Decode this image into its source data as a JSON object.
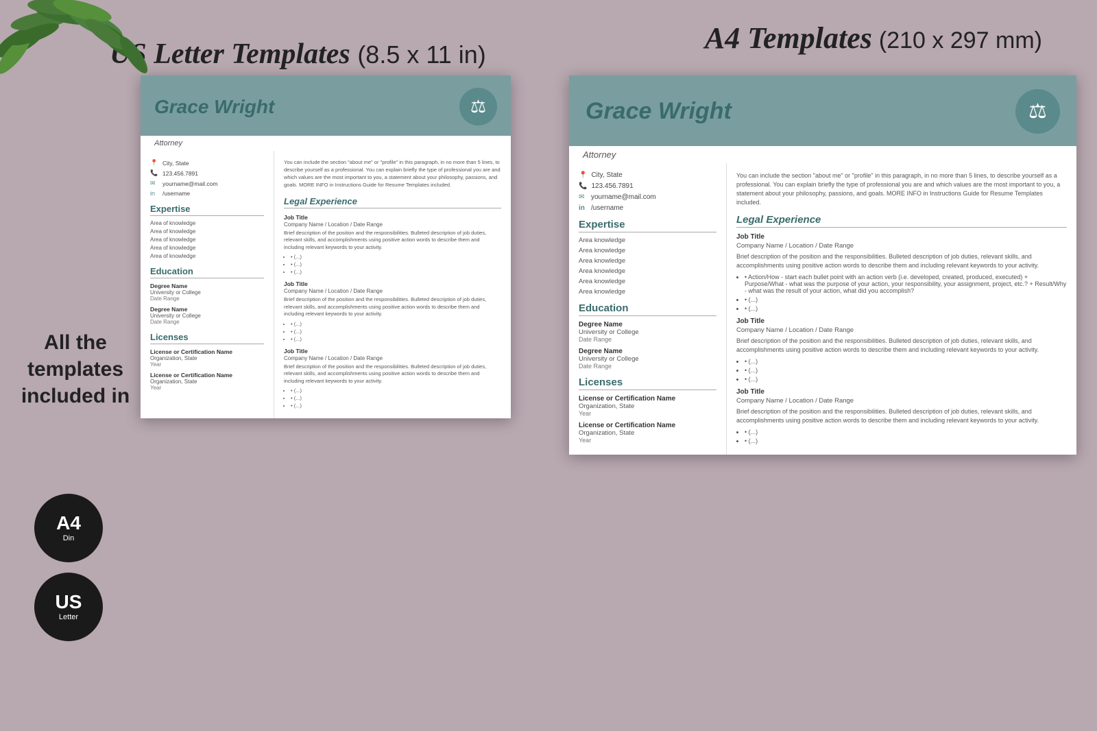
{
  "page": {
    "background_color": "#b8a8b0"
  },
  "title_left": {
    "script_part": "US Letter Templates",
    "normal_part": "(8.5 x 11 in)"
  },
  "title_right": {
    "script_part": "A4 Templates",
    "normal_part": "(210 x 297 mm)"
  },
  "side_text": "All the templates included in",
  "badges": [
    {
      "main": "A4",
      "sub": "Din"
    },
    {
      "main": "US",
      "sub": "Letter"
    }
  ],
  "resume_left": {
    "name": "Grace Wright",
    "title": "Attorney",
    "contact": {
      "location": "City, State",
      "phone": "123.456.7891",
      "email": "yourname@mail.com",
      "linkedin": "/username"
    },
    "expertise_section": "Expertise",
    "expertise_items": [
      "Area of knowledge",
      "Area of knowledge",
      "Area of knowledge",
      "Area of knowledge",
      "Area of knowledge"
    ],
    "education_section": "Education",
    "education": [
      {
        "degree": "Degree Name",
        "school": "University or College",
        "date": "Date Range"
      },
      {
        "degree": "Degree Name",
        "school": "University or College",
        "date": "Date Range"
      }
    ],
    "licenses_section": "Licenses",
    "licenses": [
      {
        "name": "License or Certification Name",
        "org": "Organization, State",
        "year": "Year"
      },
      {
        "name": "License or Certification Name",
        "org": "Organization, State",
        "year": "Year"
      }
    ],
    "legal_exp_section": "Legal Experience",
    "jobs": [
      {
        "title": "Job Title",
        "company": "Company Name / Location / Date Range",
        "desc": "Brief description of the position and the responsibilities. Bulleted description of job duties, relevant skills, and accomplishments using positive action words to describe them and including relevant keywords to your activity.",
        "bullets": [
          "(...)",
          "(...)",
          "(...)"
        ]
      },
      {
        "title": "Job Title",
        "company": "Company Name / Location / Date Range",
        "desc": "Brief description of the position and the responsibilities. Bulleted description of job duties, relevant skills, and accomplishments using positive action words to describe them and including relevant keywords to your activity.",
        "bullets": [
          "(...)",
          "(...)",
          "(...)"
        ]
      },
      {
        "title": "Job Title",
        "company": "Company Name / Location / Date Range",
        "desc": "Brief description of the position and the responsibilities. Bulleted description of job duties, relevant skills, and accomplishments using positive action words to describe them and including relevant keywords to your activity.",
        "bullets": [
          "(...)",
          "(...)",
          "(...)"
        ]
      }
    ],
    "about_text": "You can include the section \"about me\" or \"profile\" in this paragraph, in no more than 5 lines, to describe yourself as a professional. You can explain briefly the type of professional you are and which values are the most important to you, a statement about your philosophy, passions, and goals. MORE INFO in Instructions Guide for Resume Templates included."
  },
  "resume_right": {
    "name": "Grace Wright",
    "title": "Attorney",
    "contact": {
      "location": "City, State",
      "phone": "123.456.7891",
      "email": "yourname@mail.com",
      "linkedin": "/username"
    },
    "expertise_section": "Expertise",
    "expertise_items": [
      "Area knowledge",
      "Area knowledge",
      "Area knowledge",
      "Area knowledge",
      "Area knowledge",
      "Area knowledge"
    ],
    "education_section": "Education",
    "education": [
      {
        "degree": "Degree Name",
        "school": "University or College",
        "date": "Date Range"
      },
      {
        "degree": "Degree Name",
        "school": "University or College",
        "date": "Date Range"
      }
    ],
    "licenses_section": "Licenses",
    "licenses": [
      {
        "name": "License or Certification Name",
        "org": "Organization, State",
        "year": "Year"
      },
      {
        "name": "License or Certification Name",
        "org": "Organization, State",
        "year": "Year"
      }
    ],
    "legal_exp_section": "Legal Experience",
    "jobs": [
      {
        "title": "Job Title",
        "company": "Company Name / Location / Date Range",
        "desc": "Brief description of the position and the responsibilities. Bulleted description of job duties, relevant skills, and accomplishments using positive action words to describe them and including relevant keywords to your activity.",
        "bullets": [
          "Action/How - start each bullet point with an action verb (i.e. developed, created, produced, executed) + Purpose/What - what was the purpose of your action, your responsibility, your assignment, project, etc.? + Result/Why - what was the result of your action, what did you accomplish?",
          "(...)",
          "(...)"
        ]
      },
      {
        "title": "Job Title",
        "company": "Company Name / Location / Date Range",
        "desc": "Brief description of the position and the responsibilities. Bulleted description of job duties, relevant skills, and accomplishments using positive action words to describe them and including relevant keywords to your activity.",
        "bullets": [
          "(...)",
          "(...)",
          "(...)"
        ]
      },
      {
        "title": "Job Title",
        "company": "Company Name / Location / Date Range",
        "desc": "Brief description of the position and the responsibilities. Bulleted description of job duties, relevant skills, and accomplishments using positive action words to describe them and including relevant keywords to your activity.",
        "bullets": [
          "(...)",
          "(...)"
        ]
      }
    ],
    "about_text": "You can include the section \"about me\" or \"profile\" in this paragraph, in no more than 5 lines, to describe yourself as a professional. You can explain briefly the type of professional you are and which values are the most important to you, a statement about your philosophy, passions, and goals. MORE INFO in Instructions Guide for Resume Templates included."
  }
}
